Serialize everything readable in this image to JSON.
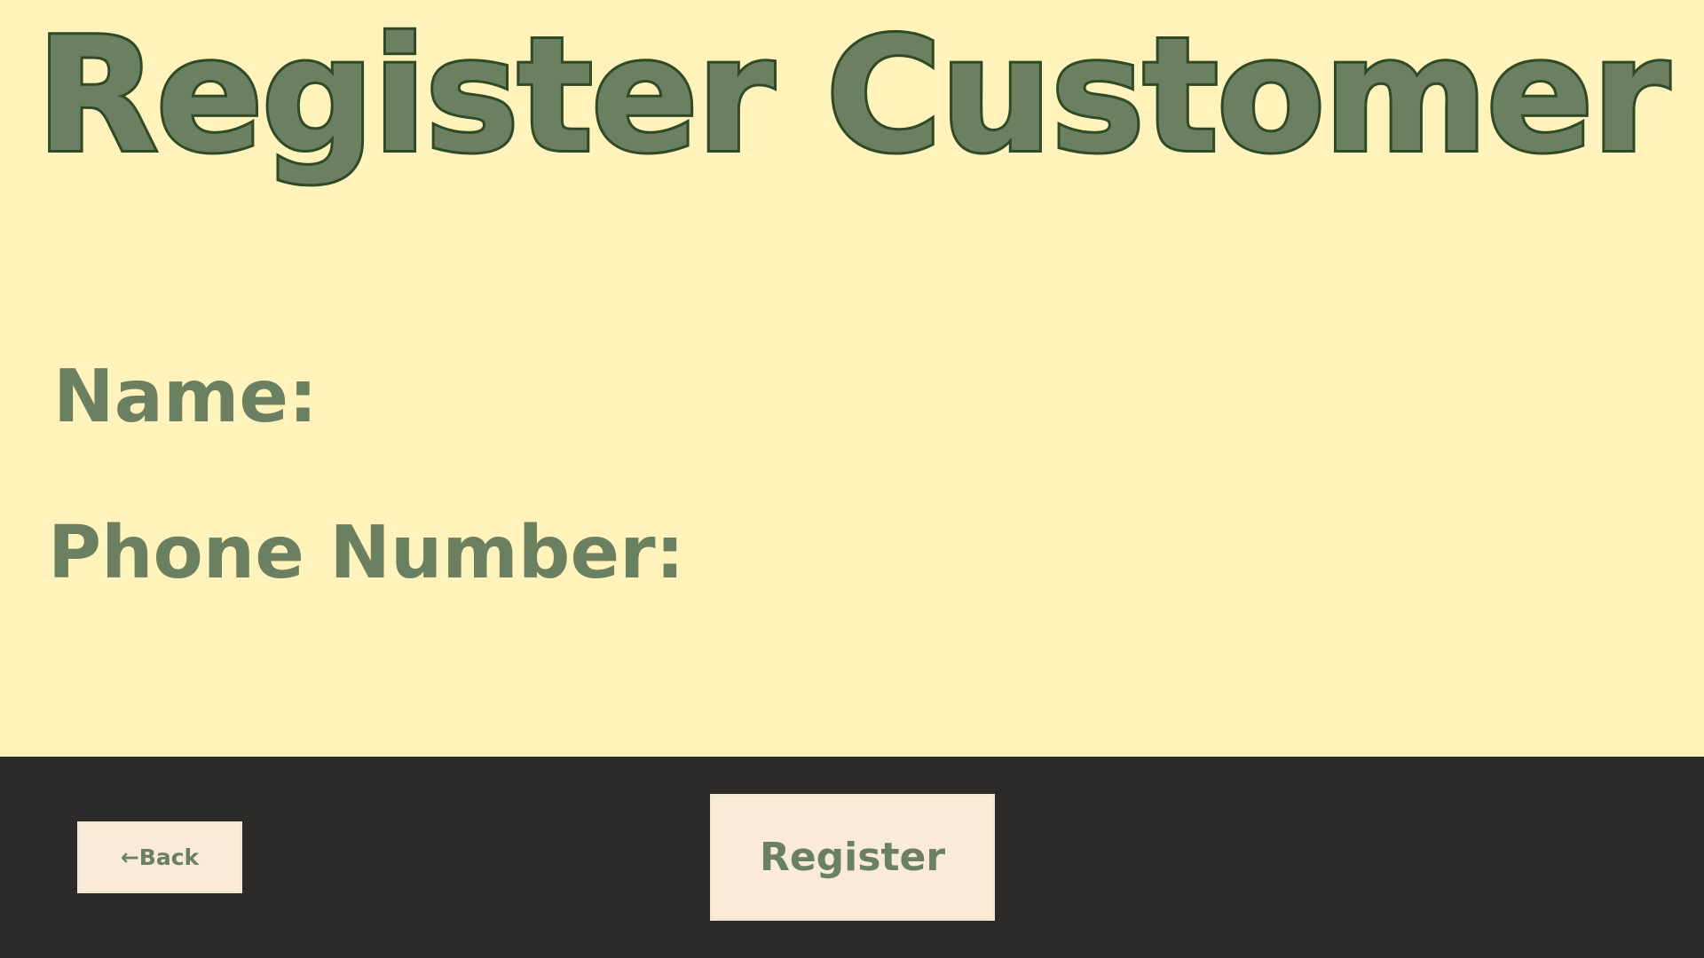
{
  "page": {
    "title": "Register Customer"
  },
  "form": {
    "name_label": "Name:",
    "name_value": "",
    "phone_label": "Phone Number:",
    "phone_value": ""
  },
  "footer": {
    "back_label": "←Back",
    "register_label": "Register"
  },
  "colors": {
    "background": "#FFF2BB",
    "accent_green": "#6A8060",
    "title_outline": "#2E4A26",
    "footer_bar": "#2D2A2A",
    "button_fill": "#FAEBD7"
  }
}
